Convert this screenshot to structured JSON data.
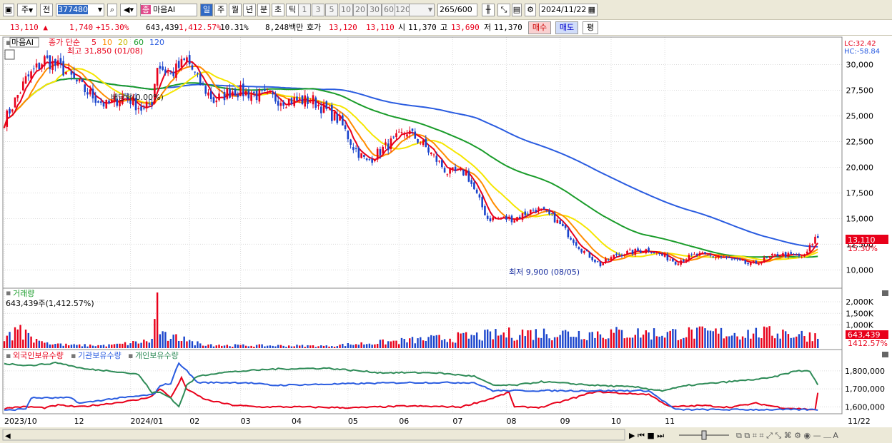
{
  "toolbar": {
    "period_select": "주",
    "prev_label": "전",
    "code": "377480",
    "name": "마음AI",
    "name_badge": "종",
    "tabs": [
      "일",
      "주",
      "월",
      "년",
      "분",
      "초",
      "틱"
    ],
    "nums": [
      "1",
      "3",
      "5",
      "10",
      "20",
      "30",
      "60",
      "120"
    ],
    "count": "265",
    "count_total": "/600",
    "date": "2024/11/22"
  },
  "info": {
    "price": "13,110",
    "change": "1,740",
    "change_pct": "+15.30%",
    "volume": "643,439",
    "volume_pct": "1,412.57%",
    "turnover": "10.31%",
    "amount": "8,248백만",
    "hoga_label": "호가",
    "hoga1": "13,120",
    "hoga2": "13,110",
    "open_label": "시",
    "open": "11,370",
    "high_label": "고",
    "high": "13,690",
    "low_label": "저",
    "low": "11,370",
    "buy": "매수",
    "sell": "매도",
    "avg": "평"
  },
  "legend": {
    "name": "마음AI",
    "ma_label": "종가 단순",
    "ma_periods": [
      "5",
      "10",
      "20",
      "60",
      "120"
    ],
    "lc": "LC:32.42",
    "hc": "HC:-58.84"
  },
  "annotations": {
    "high": "최고 31,850 (01/08)",
    "low": "최저 9,900 (08/05)",
    "dividend": "배당락(0.00%)"
  },
  "volume_panel": {
    "title": "거래량",
    "value": "643,439주(1,412.57%)",
    "tag": "643,439",
    "tag_pct": "1412.57%"
  },
  "holdings_panel": {
    "series": [
      "외국인보유수량",
      "기관보유수량",
      "개인보유수량"
    ]
  },
  "colors": {
    "up": "#e8001a",
    "down": "#1a44cc",
    "ma5": "#e8001a",
    "ma10": "#ff8c00",
    "ma20": "#f5e600",
    "ma60": "#1a9c2a",
    "ma120": "#2a5ce0"
  },
  "chart_data": {
    "type": "candlestick",
    "price_axis": {
      "ticks": [
        "30,000",
        "27,500",
        "25,000",
        "22,500",
        "20,000",
        "17,500",
        "15,000",
        "12,500",
        "10,000"
      ],
      "min": 8500,
      "max": 32400
    },
    "current_price_tag": "13,110",
    "current_pct_tag": "15.30%",
    "volume_axis": {
      "ticks": [
        "2,000K",
        "1,500K",
        "1,000K"
      ],
      "max": 2400000
    },
    "holdings_axis": {
      "ticks": [
        "1,800,000",
        "1,700,000",
        "1,600,000"
      ],
      "min": 1570000,
      "max": 1855000
    },
    "x_labels": [
      "2023/10",
      "12",
      "2024/01",
      "02",
      "03",
      "04",
      "05",
      "06",
      "07",
      "08",
      "09",
      "10",
      "11",
      "11/22"
    ],
    "close_anchors": [
      [
        0,
        24500
      ],
      [
        8,
        28500
      ],
      [
        15,
        30500
      ],
      [
        22,
        29500
      ],
      [
        30,
        27500
      ],
      [
        38,
        26000
      ],
      [
        45,
        27000
      ],
      [
        52,
        25500
      ],
      [
        55,
        26500
      ],
      [
        57,
        30000
      ],
      [
        62,
        29000
      ],
      [
        68,
        30500
      ],
      [
        72,
        28500
      ],
      [
        78,
        26500
      ],
      [
        85,
        27500
      ],
      [
        95,
        27000
      ],
      [
        105,
        26500
      ],
      [
        115,
        26500
      ],
      [
        125,
        24500
      ],
      [
        130,
        22000
      ],
      [
        135,
        20500
      ],
      [
        142,
        22000
      ],
      [
        150,
        23500
      ],
      [
        155,
        22500
      ],
      [
        165,
        19500
      ],
      [
        172,
        19500
      ],
      [
        180,
        15000
      ],
      [
        190,
        15000
      ],
      [
        198,
        16000
      ],
      [
        205,
        15000
      ],
      [
        215,
        12000
      ],
      [
        222,
        10500
      ],
      [
        228,
        11500
      ],
      [
        240,
        12000
      ],
      [
        250,
        10800
      ],
      [
        258,
        11500
      ],
      [
        268,
        11200
      ],
      [
        278,
        10500
      ],
      [
        288,
        11500
      ],
      [
        298,
        11300
      ],
      [
        302,
        13110
      ]
    ],
    "volume_bars": [
      [
        0,
        300
      ],
      [
        2,
        700
      ],
      [
        4,
        900
      ],
      [
        6,
        1000
      ],
      [
        8,
        800
      ],
      [
        9,
        650
      ],
      [
        10,
        500
      ],
      [
        12,
        400
      ],
      [
        14,
        300
      ],
      [
        16,
        250
      ],
      [
        20,
        200
      ],
      [
        25,
        150
      ],
      [
        40,
        150
      ],
      [
        55,
        400
      ],
      [
        57,
        2400
      ],
      [
        58,
        600
      ],
      [
        60,
        700
      ],
      [
        62,
        400
      ],
      [
        64,
        600
      ],
      [
        67,
        500
      ],
      [
        70,
        300
      ],
      [
        80,
        150
      ],
      [
        120,
        120
      ],
      [
        193,
        800
      ],
      [
        290,
        800
      ],
      [
        302,
        643
      ]
    ],
    "holdings": {
      "foreign": [
        [
          0,
          1590000
        ],
        [
          5,
          1600000
        ],
        [
          10,
          1600000
        ],
        [
          15,
          1595000
        ],
        [
          20,
          1610000
        ],
        [
          28,
          1600000
        ],
        [
          40,
          1620000
        ],
        [
          50,
          1640000
        ],
        [
          55,
          1660000
        ],
        [
          58,
          1700000
        ],
        [
          60,
          1680000
        ],
        [
          62,
          1650000
        ],
        [
          66,
          1760000
        ],
        [
          68,
          1700000
        ],
        [
          70,
          1680000
        ],
        [
          75,
          1640000
        ],
        [
          85,
          1610000
        ],
        [
          95,
          1600000
        ],
        [
          110,
          1600000
        ],
        [
          130,
          1595000
        ],
        [
          150,
          1605000
        ],
        [
          170,
          1600000
        ],
        [
          180,
          1640000
        ],
        [
          188,
          1680000
        ],
        [
          190,
          1600000
        ],
        [
          200,
          1598000
        ],
        [
          210,
          1640000
        ],
        [
          220,
          1685000
        ],
        [
          230,
          1675000
        ],
        [
          240,
          1670000
        ],
        [
          248,
          1600000
        ],
        [
          260,
          1608000
        ],
        [
          270,
          1598000
        ],
        [
          280,
          1620000
        ],
        [
          290,
          1595000
        ],
        [
          302,
          1585000
        ],
        [
          303,
          1680000
        ]
      ],
      "institution": [
        [
          0,
          1580000
        ],
        [
          8,
          1590000
        ],
        [
          10,
          1650000
        ],
        [
          25,
          1650000
        ],
        [
          28,
          1620000
        ],
        [
          40,
          1645000
        ],
        [
          50,
          1660000
        ],
        [
          56,
          1670000
        ],
        [
          58,
          1720000
        ],
        [
          62,
          1730000
        ],
        [
          65,
          1845000
        ],
        [
          68,
          1800000
        ],
        [
          72,
          1735000
        ],
        [
          90,
          1735000
        ],
        [
          100,
          1720000
        ],
        [
          150,
          1735000
        ],
        [
          175,
          1735000
        ],
        [
          182,
          1690000
        ],
        [
          240,
          1690000
        ],
        [
          250,
          1585000
        ],
        [
          303,
          1585000
        ]
      ],
      "individual": [
        [
          0,
          1840000
        ],
        [
          10,
          1830000
        ],
        [
          20,
          1845000
        ],
        [
          30,
          1810000
        ],
        [
          40,
          1800000
        ],
        [
          50,
          1780000
        ],
        [
          55,
          1680000
        ],
        [
          58,
          1680000
        ],
        [
          62,
          1650000
        ],
        [
          65,
          1600000
        ],
        [
          68,
          1720000
        ],
        [
          72,
          1770000
        ],
        [
          80,
          1790000
        ],
        [
          100,
          1810000
        ],
        [
          120,
          1815000
        ],
        [
          140,
          1790000
        ],
        [
          160,
          1790000
        ],
        [
          175,
          1770000
        ],
        [
          182,
          1720000
        ],
        [
          190,
          1720000
        ],
        [
          200,
          1740000
        ],
        [
          220,
          1720000
        ],
        [
          235,
          1710000
        ],
        [
          245,
          1690000
        ],
        [
          255,
          1720000
        ],
        [
          270,
          1740000
        ],
        [
          285,
          1760000
        ],
        [
          295,
          1800000
        ],
        [
          300,
          1800000
        ],
        [
          303,
          1720000
        ]
      ]
    }
  }
}
